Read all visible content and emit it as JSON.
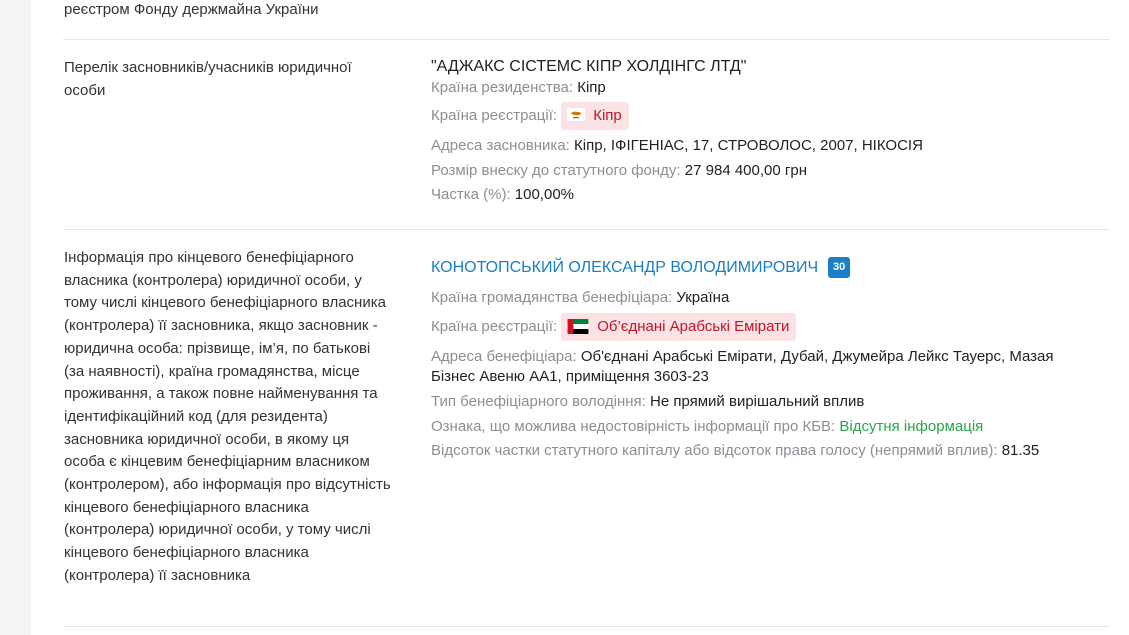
{
  "top_text": "реєстром Фонду держмайна України",
  "founders_section": {
    "label": "Перелік засновників/учасників юридичної особи",
    "name": "\"АДЖАКС СІСТЕМС КІПР ХОЛДІНГС ЛТД\"",
    "residence_label": "Країна резиденства:",
    "residence_value": "Кіпр",
    "registration_label": "Країна реєстрації:",
    "registration_value": "Кіпр",
    "registration_flag": "cyprus-flag-icon",
    "address_label": "Адреса засновника:",
    "address_value": "Кіпр, ІФІГЕНІАС, 17, СТРОВОЛОС, 2007, НІКОСІЯ",
    "capital_label": "Розмір внеску до статутного фонду:",
    "capital_value": "27 984 400,00 грн",
    "share_label": "Частка (%):",
    "share_value": "100,00%"
  },
  "beneficiary_section": {
    "label": "Інформація про кінцевого бенефіціарного власника (контролера) юридичної особи, у тому числі кінцевого бенефіціарного власника (контролера) її засновника, якщо засновник - юридична особа: прізвище, ім’я, по батькові (за наявності), країна громадянства, місце проживання, а також повне найменування та ідентифікаційний код (для резидента) засновника юридичної особи, в якому ця особа є кінцевим бенефіціарним власником (контролером), або інформація про відсутність кінцевого бенефіціарного власника (контролера) юридичної особи, у тому числі кінцевого бенефіціарного власника (контролера) її засновника",
    "name": "КОНОТОПСЬКИЙ ОЛЕКСАНДР ВОЛОДИМИРОВИЧ",
    "badge": "30",
    "citizenship_label": "Країна громадянства бенефіціара:",
    "citizenship_value": "Україна",
    "registration_label": "Країна реєстрації:",
    "registration_value": "Об’єднані Арабські Емірати",
    "registration_flag": "uae-flag-icon",
    "address_label": "Адреса бенефіціара:",
    "address_value": "Об'єднані Арабські Емірати, Дубай, Джумейра Лейкс Тауерс, Мазая Бізнес Авеню АА1, приміщення 3603-23",
    "ownership_type_label": "Тип бенефіціарного володіння:",
    "ownership_type_value": "Не прямий вирішальний вплив",
    "inaccuracy_label": "Ознака, що можлива недостовірність інформації про КБВ:",
    "inaccuracy_value": "Відсутня інформація",
    "percent_label": "Відсоток частки статутного капіталу або відсоток права голосу (непрямий вплив):",
    "percent_value": "81.35"
  },
  "colors": {
    "link": "#1a7fc8",
    "country_tag_bg": "#fbe3e5",
    "country_tag_text": "#c3152a",
    "green": "#27a844",
    "muted": "#8a8f96"
  }
}
